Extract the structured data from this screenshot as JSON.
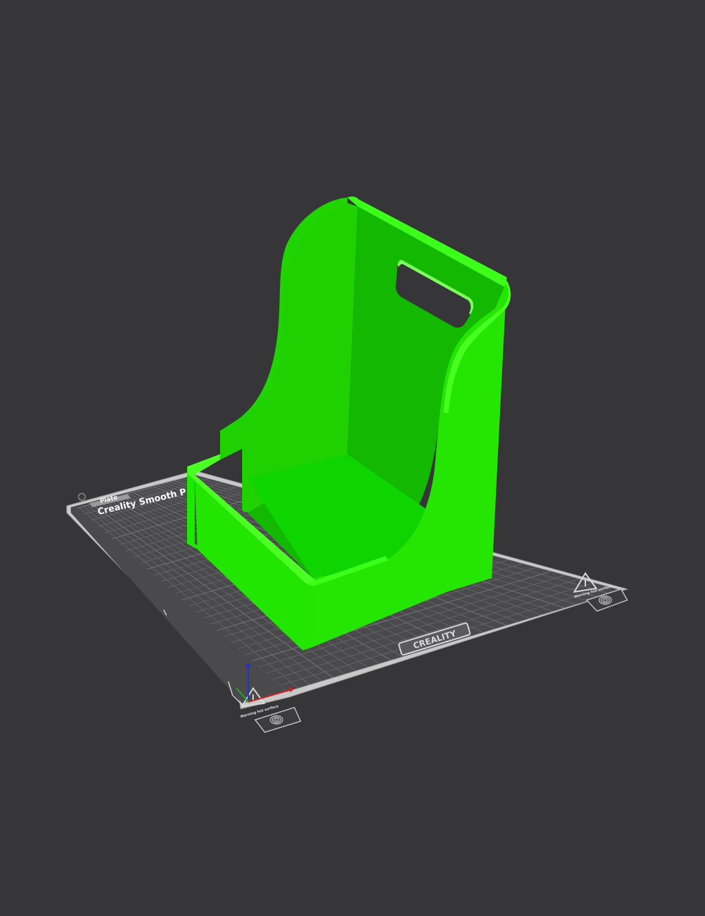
{
  "viewport": {
    "background": "#363638"
  },
  "bed": {
    "plate_label": "Plate",
    "plate_title": "Creality Smooth P",
    "logo": "CREALITY",
    "warning_left": "Warning hot surface",
    "warning_right": "Warning hot surface",
    "surface_color": "#4a4a4c",
    "frame_color": "#b8b8b8",
    "grid_color": "#6a6a6c"
  },
  "model": {
    "color": "#1fe000",
    "shade_color": "#17b800",
    "dark_color": "#0f9000",
    "light_color": "#3cff1a"
  },
  "axes": {
    "x_color": "#cc2222",
    "y_color": "#22aa22",
    "z_color": "#2233cc"
  },
  "icons": {
    "fingerprint_left": "fingerprint-icon",
    "fingerprint_right": "fingerprint-icon",
    "warning_triangle": "warning-triangle-icon"
  }
}
